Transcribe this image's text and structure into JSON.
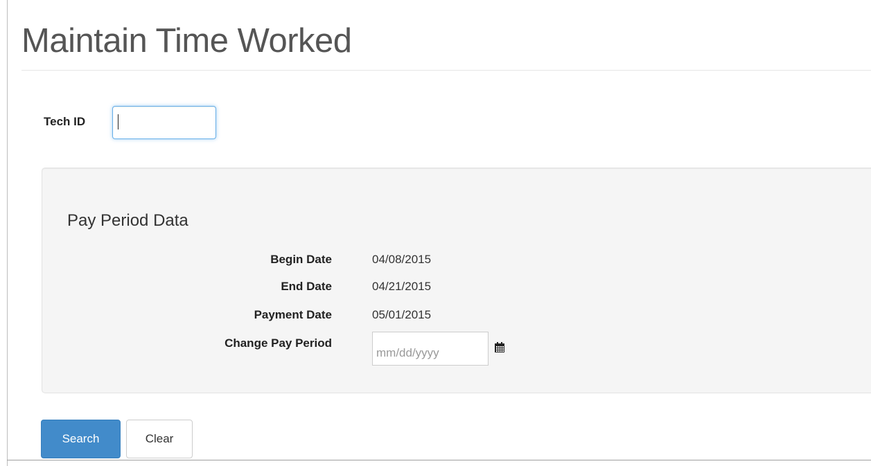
{
  "page": {
    "title": "Maintain Time Worked"
  },
  "tech_id": {
    "label": "Tech ID",
    "value": ""
  },
  "pay_period": {
    "section_title": "Pay Period Data",
    "begin_date": {
      "label": "Begin Date",
      "value": "04/08/2015"
    },
    "end_date": {
      "label": "End Date",
      "value": "04/21/2015"
    },
    "payment_date": {
      "label": "Payment Date",
      "value": "05/01/2015"
    },
    "change_pay_period": {
      "label": "Change Pay Period",
      "placeholder": "mm/dd/yyyy",
      "value": ""
    },
    "calendar_icon": "calendar-icon"
  },
  "actions": {
    "search_label": "Search",
    "clear_label": "Clear"
  },
  "colors": {
    "primary": "#428bca",
    "focus": "#66afe9",
    "well": "#f5f5f5"
  }
}
